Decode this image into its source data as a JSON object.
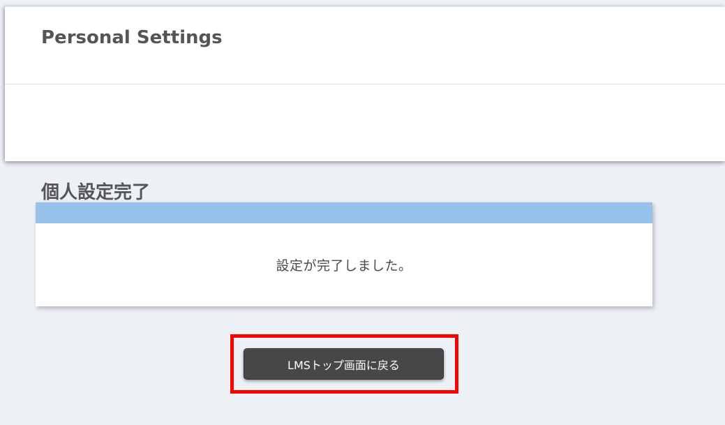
{
  "header": {
    "title": "Personal Settings",
    "subtitle": "個人設定完了"
  },
  "panel": {
    "message": "設定が完了しました。",
    "header_color": "#97c2ec"
  },
  "actions": {
    "back_to_top_label": "LMSトップ画面に戻る",
    "highlight_color": "#ff0000"
  }
}
